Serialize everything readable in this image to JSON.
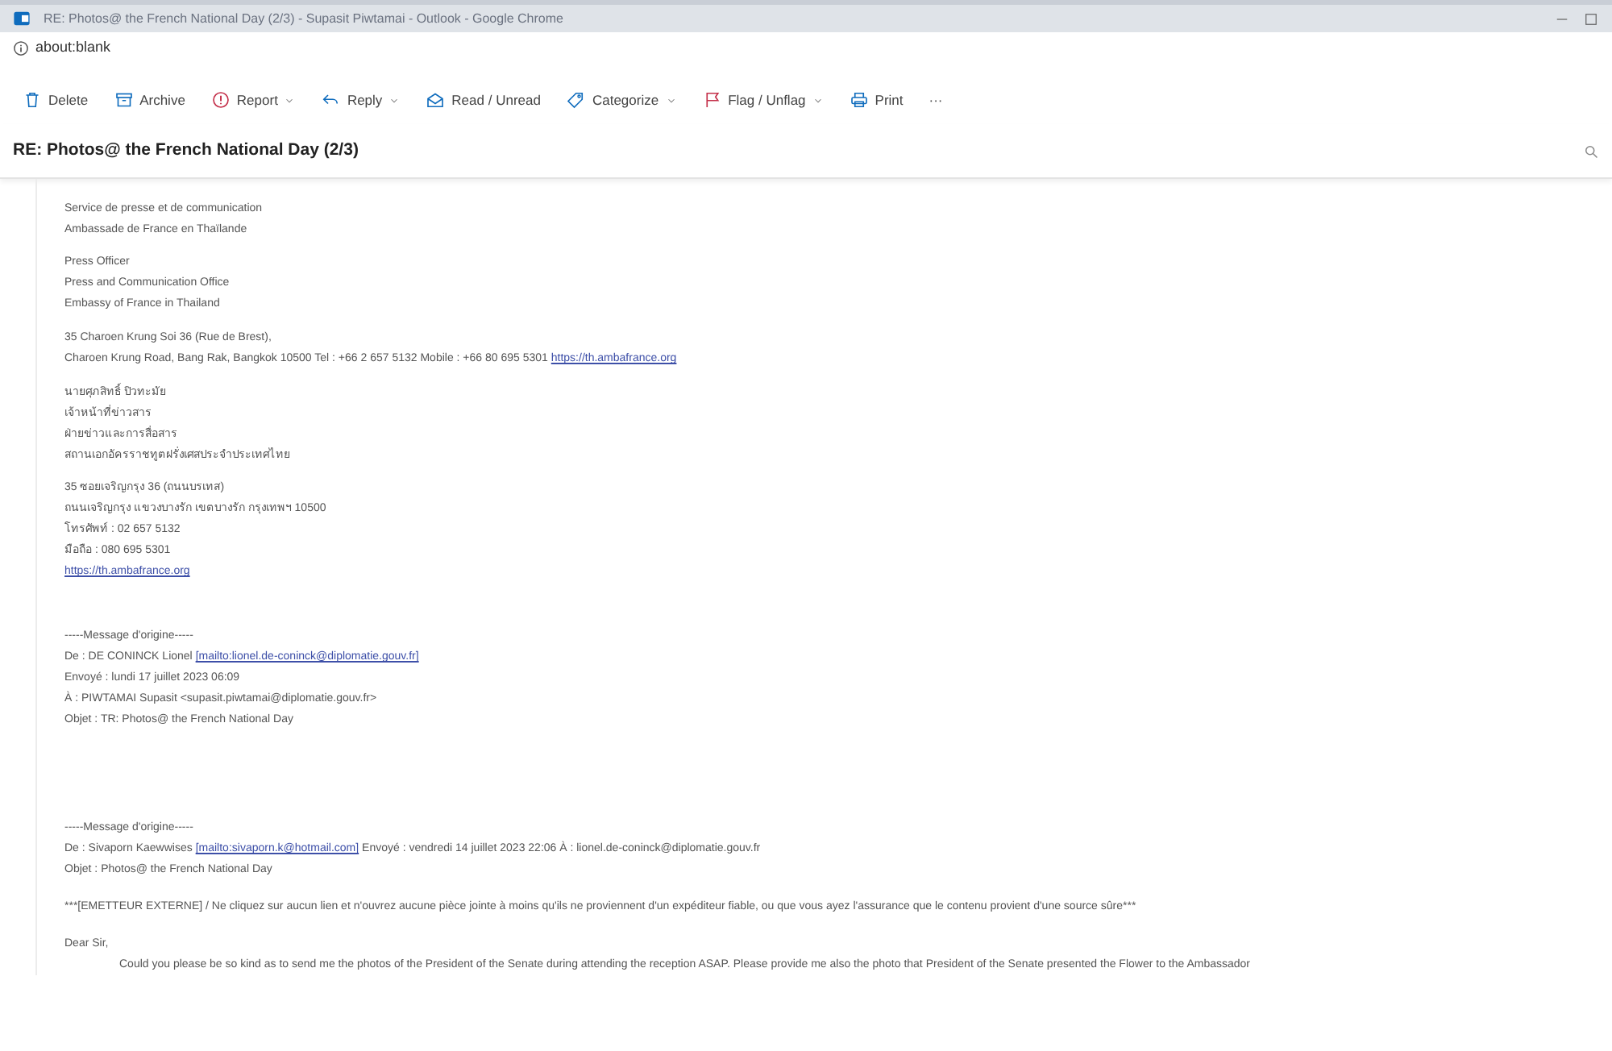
{
  "window": {
    "title": "RE: Photos@ the French National Day (2/3) - Supasit Piwtamai - Outlook - Google Chrome",
    "address": "about:blank"
  },
  "toolbar": [
    {
      "kind": "delete",
      "label": "Delete",
      "dropdown": false
    },
    {
      "kind": "archive",
      "label": "Archive",
      "dropdown": false
    },
    {
      "kind": "report",
      "label": "Report",
      "dropdown": true
    },
    {
      "kind": "reply",
      "label": "Reply",
      "dropdown": true
    },
    {
      "kind": "read",
      "label": "Read / Unread",
      "dropdown": false
    },
    {
      "kind": "categorize",
      "label": "Categorize",
      "dropdown": true
    },
    {
      "kind": "flag",
      "label": "Flag / Unflag",
      "dropdown": true
    },
    {
      "kind": "print",
      "label": "Print",
      "dropdown": false
    },
    {
      "kind": "more",
      "label": "···",
      "dropdown": false
    }
  ],
  "subject": "RE: Photos@ the French National Day (2/3)",
  "body": [
    [
      [
        {
          "kind": "text",
          "text": "Service de presse et de communication"
        }
      ],
      [
        {
          "kind": "text",
          "text": "Ambassade de France en Thaïlande"
        }
      ]
    ],
    [
      [
        {
          "kind": "text",
          "text": "Press Officer"
        }
      ],
      [
        {
          "kind": "text",
          "text": "Press and Communication Office"
        }
      ],
      [
        {
          "kind": "text",
          "text": "Embassy of France in Thailand"
        }
      ]
    ],
    [
      [
        {
          "kind": "text",
          "text": "35 Charoen Krung Soi 36 (Rue de Brest),"
        }
      ],
      [
        {
          "kind": "text",
          "text": "Charoen Krung Road, Bang Rak, Bangkok 10500 Tel : +66 2 657 5132 Mobile : +66 80 695 5301 "
        },
        {
          "kind": "link",
          "text": "https://th.ambafrance.org"
        }
      ]
    ],
    [
      [
        {
          "kind": "text",
          "text": "นายศุภสิทธิ์ ปิวทะมัย"
        }
      ],
      [
        {
          "kind": "text",
          "text": "เจ้าหน้าที่ข่าวสาร"
        }
      ],
      [
        {
          "kind": "text",
          "text": "ฝ่ายข่าวและการสื่อสาร"
        }
      ],
      [
        {
          "kind": "text",
          "text": "สถานเอกอัครราชทูตฝรั่งเศสประจำประเทศไทย"
        }
      ]
    ],
    [
      [
        {
          "kind": "text",
          "text": "35 ซอยเจริญกรุง 36 (ถนนบรเทส)"
        }
      ],
      [
        {
          "kind": "text",
          "text": "ถนนเจริญกรุง แขวงบางรัก เขตบางรัก กรุงเทพฯ 10500"
        }
      ],
      [
        {
          "kind": "text",
          "text": "โทรศัพท์ : 02 657 5132"
        }
      ],
      [
        {
          "kind": "text",
          "text": "มือถือ : 080 695 5301"
        }
      ],
      [
        {
          "kind": "link",
          "text": "https://th.ambafrance.org"
        }
      ]
    ],
    [
      [
        {
          "kind": "text",
          "text": "-----Message d'origine-----"
        }
      ],
      [
        {
          "kind": "text",
          "text": "De : DE CONINCK Lionel "
        },
        {
          "kind": "link",
          "text": "[mailto:lionel.de-coninck@diplomatie.gouv.fr]"
        }
      ],
      [
        {
          "kind": "text",
          "text": "Envoyé : lundi 17 juillet 2023 06:09"
        }
      ],
      [
        {
          "kind": "text",
          "text": "À : PIWTAMAI Supasit <supasit.piwtamai@diplomatie.gouv.fr>"
        }
      ],
      [
        {
          "kind": "text",
          "text": "Objet : TR: Photos@ the French National Day"
        }
      ]
    ],
    [
      [
        {
          "kind": "text",
          "text": "-----Message d'origine-----"
        }
      ],
      [
        {
          "kind": "text",
          "text": "De : Sivaporn Kaewwises "
        },
        {
          "kind": "link",
          "text": "[mailto:sivaporn.k@hotmail.com]"
        },
        {
          "kind": "text",
          "text": " Envoyé : vendredi 14 juillet 2023 22:06 À : lionel.de-coninck@diplomatie.gouv.fr"
        }
      ],
      [
        {
          "kind": "text",
          "text": "Objet : Photos@ the French National Day"
        }
      ]
    ],
    [
      [
        {
          "kind": "text",
          "text": "***[EMETTEUR EXTERNE] / Ne cliquez sur aucun lien et n'ouvrez aucune pièce jointe à moins qu'ils ne proviennent d'un expéditeur fiable, ou que vous ayez l'assurance que le contenu provient d'une source sûre***"
        }
      ]
    ],
    [
      [
        {
          "kind": "text",
          "text": "Dear Sir,"
        }
      ],
      [
        {
          "kind": "indent",
          "text": "Could you please be so kind as to send me the photos of the President of the Senate during attending the reception ASAP. Please provide me also the photo that  President of the Senate presented the Flower to the Ambassador"
        }
      ]
    ]
  ]
}
